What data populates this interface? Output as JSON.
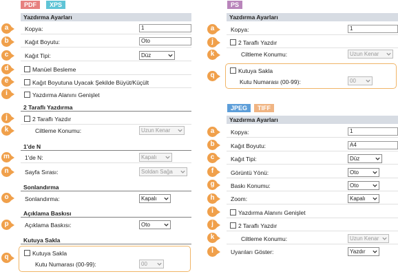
{
  "left": {
    "tags": [
      "PDF",
      "XPS"
    ],
    "header": "Yazdırma Ayarları",
    "copies_label": "Kopya:",
    "copies_value": "1",
    "paper_size_label": "Kağıt Boyutu:",
    "paper_size_value": "Oto",
    "paper_type_label": "Kağıt Tipi:",
    "paper_type_value": "Düz",
    "manual_feed_label": "Manüel Besleme",
    "scale_to_paper_label": "Kağıt Boyutuna Uyacak Şekilde Büyüt/Küçült",
    "enlarge_print_area_label": "Yazdırma Alanını Genişlet",
    "sec_duplex": "2 Taraflı Yazdırma",
    "duplex_label": "2 Taraflı Yazdır",
    "binding_label": "Ciltleme Konumu:",
    "binding_value": "Uzun Kenar",
    "sec_nup": "1'de N",
    "nup_label": "1'de N:",
    "nup_value": "Kapalı",
    "page_order_label": "Sayfa Sırası:",
    "page_order_value": "Soldan Sağa",
    "sec_finishing": "Sonlandırma",
    "finishing_label": "Sonlandırma:",
    "finishing_value": "Kapalı",
    "sec_annotation": "Açıklama Baskısı",
    "annotation_label": "Açıklama Baskısı:",
    "annotation_value": "Oto",
    "sec_mailbox": "Kutuya Sakla",
    "mailbox_label": "Kutuya Sakla",
    "box_number_label": "Kutu Numarası (00-99):",
    "box_number_value": "00"
  },
  "ps": {
    "tag": "PS",
    "header": "Yazdırma Ayarları",
    "copies_label": "Kopya:",
    "copies_value": "1",
    "duplex_label": "2 Taraflı Yazdır",
    "binding_label": "Ciltleme Konumu:",
    "binding_value": "Uzun Kenar",
    "mailbox_label": "Kutuya Sakla",
    "box_number_label": "Kutu Numarası (00-99):",
    "box_number_value": "00"
  },
  "img": {
    "tags": [
      "JPEG",
      "TIFF"
    ],
    "header": "Yazdırma Ayarları",
    "copies_label": "Kopya:",
    "copies_value": "1",
    "paper_size_label": "Kağıt Boyutu:",
    "paper_size_value": "A4",
    "paper_type_label": "Kağıt Tipi:",
    "paper_type_value": "Düz",
    "orientation_label": "Görüntü Yönü:",
    "orientation_value": "Oto",
    "print_position_label": "Baskı Konumu:",
    "print_position_value": "Oto",
    "zoom_label": "Zoom:",
    "zoom_value": "Kapalı",
    "enlarge_print_area_label": "Yazdırma Alanını Genişlet",
    "duplex_label": "2 Taraflı Yazdır",
    "binding_label": "Ciltleme Konumu:",
    "binding_value": "Uzun Kenar",
    "warnings_label": "Uyarıları Göster:",
    "warnings_value": "Yazdır"
  },
  "badges": {
    "a": "a",
    "b": "b",
    "c": "c",
    "d": "d",
    "e": "e",
    "f": "f",
    "g": "g",
    "h": "h",
    "i": "i",
    "j": "j",
    "k": "k",
    "l": "l",
    "m": "m",
    "n": "n",
    "o": "o",
    "p": "p",
    "q": "q"
  },
  "colors": {
    "badge": "#f0a04b",
    "header_bg": "#d7dce3",
    "pdf_tag": "#e6807f",
    "xps_tag": "#5fc4d6",
    "ps_tag": "#b985bb",
    "jpeg_tag": "#5d9ed9",
    "tiff_tag": "#f0b482"
  }
}
